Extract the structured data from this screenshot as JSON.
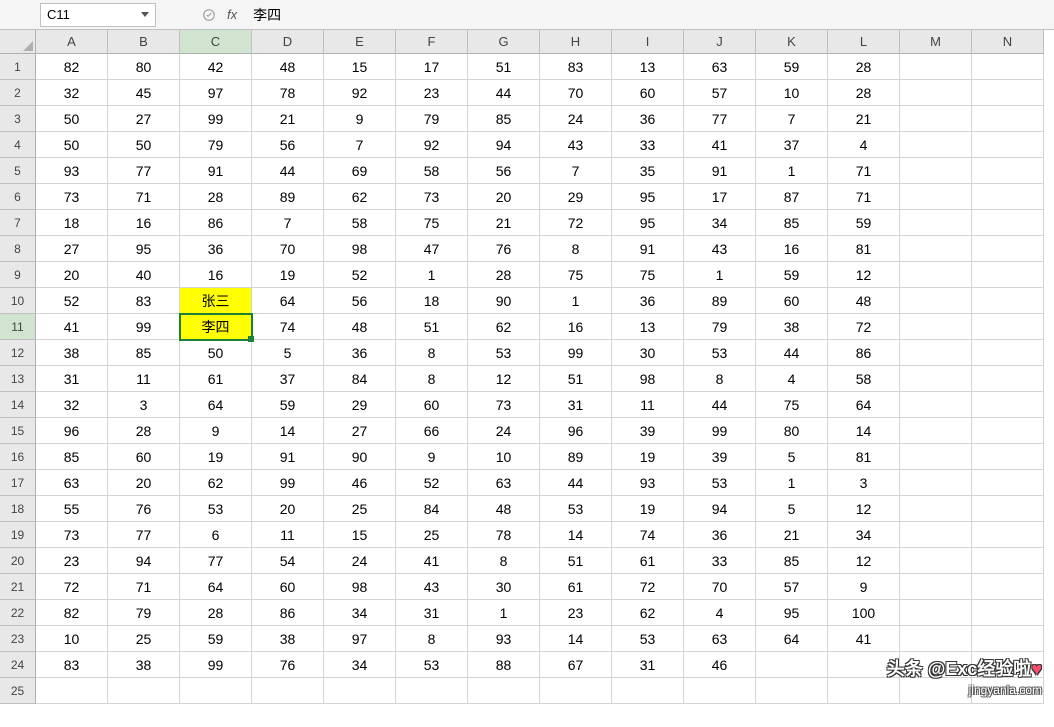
{
  "name_box": "C11",
  "formula_value": "李四",
  "fx_label": "fx",
  "columns": [
    "A",
    "B",
    "C",
    "D",
    "E",
    "F",
    "G",
    "H",
    "I",
    "J",
    "K",
    "L",
    "M",
    "N"
  ],
  "active_col_index": 2,
  "active_row_index": 10,
  "selected_cell": {
    "row": 10,
    "col": 2
  },
  "highlighted_cells": [
    {
      "row": 9,
      "col": 2
    },
    {
      "row": 10,
      "col": 2
    }
  ],
  "rows": [
    {
      "num": "1",
      "cells": [
        "82",
        "80",
        "42",
        "48",
        "15",
        "17",
        "51",
        "83",
        "13",
        "63",
        "59",
        "28",
        "",
        ""
      ]
    },
    {
      "num": "2",
      "cells": [
        "32",
        "45",
        "97",
        "78",
        "92",
        "23",
        "44",
        "70",
        "60",
        "57",
        "10",
        "28",
        "",
        ""
      ]
    },
    {
      "num": "3",
      "cells": [
        "50",
        "27",
        "99",
        "21",
        "9",
        "79",
        "85",
        "24",
        "36",
        "77",
        "7",
        "21",
        "",
        ""
      ]
    },
    {
      "num": "4",
      "cells": [
        "50",
        "50",
        "79",
        "56",
        "7",
        "92",
        "94",
        "43",
        "33",
        "41",
        "37",
        "4",
        "",
        ""
      ]
    },
    {
      "num": "5",
      "cells": [
        "93",
        "77",
        "91",
        "44",
        "69",
        "58",
        "56",
        "7",
        "35",
        "91",
        "1",
        "71",
        "",
        ""
      ]
    },
    {
      "num": "6",
      "cells": [
        "73",
        "71",
        "28",
        "89",
        "62",
        "73",
        "20",
        "29",
        "95",
        "17",
        "87",
        "71",
        "",
        ""
      ]
    },
    {
      "num": "7",
      "cells": [
        "18",
        "16",
        "86",
        "7",
        "58",
        "75",
        "21",
        "72",
        "95",
        "34",
        "85",
        "59",
        "",
        ""
      ]
    },
    {
      "num": "8",
      "cells": [
        "27",
        "95",
        "36",
        "70",
        "98",
        "47",
        "76",
        "8",
        "91",
        "43",
        "16",
        "81",
        "",
        ""
      ]
    },
    {
      "num": "9",
      "cells": [
        "20",
        "40",
        "16",
        "19",
        "52",
        "1",
        "28",
        "75",
        "75",
        "1",
        "59",
        "12",
        "",
        ""
      ]
    },
    {
      "num": "10",
      "cells": [
        "52",
        "83",
        "张三",
        "64",
        "56",
        "18",
        "90",
        "1",
        "36",
        "89",
        "60",
        "48",
        "",
        ""
      ]
    },
    {
      "num": "11",
      "cells": [
        "41",
        "99",
        "李四",
        "74",
        "48",
        "51",
        "62",
        "16",
        "13",
        "79",
        "38",
        "72",
        "",
        ""
      ]
    },
    {
      "num": "12",
      "cells": [
        "38",
        "85",
        "50",
        "5",
        "36",
        "8",
        "53",
        "99",
        "30",
        "53",
        "44",
        "86",
        "",
        ""
      ]
    },
    {
      "num": "13",
      "cells": [
        "31",
        "11",
        "61",
        "37",
        "84",
        "8",
        "12",
        "51",
        "98",
        "8",
        "4",
        "58",
        "",
        ""
      ]
    },
    {
      "num": "14",
      "cells": [
        "32",
        "3",
        "64",
        "59",
        "29",
        "60",
        "73",
        "31",
        "11",
        "44",
        "75",
        "64",
        "",
        ""
      ]
    },
    {
      "num": "15",
      "cells": [
        "96",
        "28",
        "9",
        "14",
        "27",
        "66",
        "24",
        "96",
        "39",
        "99",
        "80",
        "14",
        "",
        ""
      ]
    },
    {
      "num": "16",
      "cells": [
        "85",
        "60",
        "19",
        "91",
        "90",
        "9",
        "10",
        "89",
        "19",
        "39",
        "5",
        "81",
        "",
        ""
      ]
    },
    {
      "num": "17",
      "cells": [
        "63",
        "20",
        "62",
        "99",
        "46",
        "52",
        "63",
        "44",
        "93",
        "53",
        "1",
        "3",
        "",
        ""
      ]
    },
    {
      "num": "18",
      "cells": [
        "55",
        "76",
        "53",
        "20",
        "25",
        "84",
        "48",
        "53",
        "19",
        "94",
        "5",
        "12",
        "",
        ""
      ]
    },
    {
      "num": "19",
      "cells": [
        "73",
        "77",
        "6",
        "11",
        "15",
        "25",
        "78",
        "14",
        "74",
        "36",
        "21",
        "34",
        "",
        ""
      ]
    },
    {
      "num": "20",
      "cells": [
        "23",
        "94",
        "77",
        "54",
        "24",
        "41",
        "8",
        "51",
        "61",
        "33",
        "85",
        "12",
        "",
        ""
      ]
    },
    {
      "num": "21",
      "cells": [
        "72",
        "71",
        "64",
        "60",
        "98",
        "43",
        "30",
        "61",
        "72",
        "70",
        "57",
        "9",
        "",
        ""
      ]
    },
    {
      "num": "22",
      "cells": [
        "82",
        "79",
        "28",
        "86",
        "34",
        "31",
        "1",
        "23",
        "62",
        "4",
        "95",
        "100",
        "",
        ""
      ]
    },
    {
      "num": "23",
      "cells": [
        "10",
        "25",
        "59",
        "38",
        "97",
        "8",
        "93",
        "14",
        "53",
        "63",
        "64",
        "41",
        "",
        ""
      ]
    },
    {
      "num": "24",
      "cells": [
        "83",
        "38",
        "99",
        "76",
        "34",
        "53",
        "88",
        "67",
        "31",
        "46",
        "",
        "",
        "",
        ""
      ]
    },
    {
      "num": "25",
      "cells": [
        "",
        "",
        "",
        "",
        "",
        "",
        "",
        "",
        "",
        "",
        "",
        "",
        "",
        ""
      ]
    }
  ],
  "watermark": {
    "main": "头条 @Exc经验啦",
    "sub": "jingyanla.com"
  }
}
